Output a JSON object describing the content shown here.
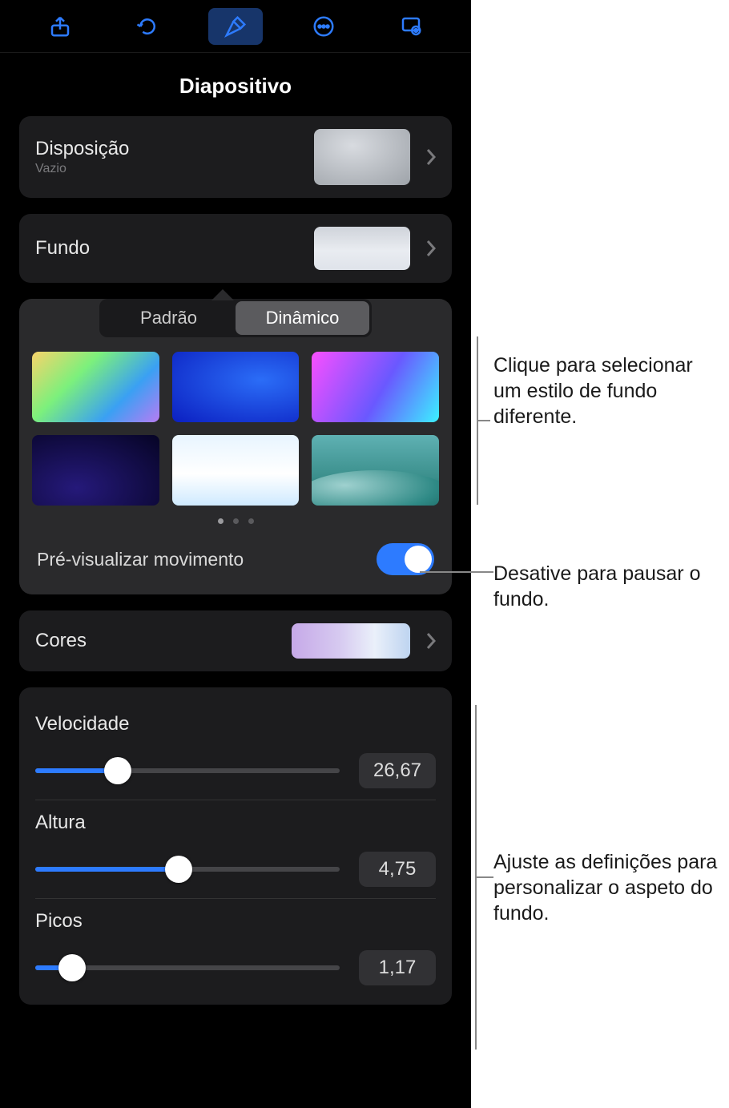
{
  "toolbar": {
    "icons": [
      "share-icon",
      "undo-icon",
      "format-icon",
      "more-icon",
      "presenter-icon"
    ],
    "active_index": 2
  },
  "header": {
    "title": "Diapositivo"
  },
  "layout_row": {
    "label": "Disposição",
    "sublabel": "Vazio"
  },
  "fundo_row": {
    "label": "Fundo"
  },
  "segmented": {
    "options": [
      "Padrão",
      "Dinâmico"
    ],
    "active_index": 1
  },
  "bg_tiles": [
    "rainbow",
    "deep-blue",
    "magenta-cyan",
    "nebula",
    "white-cloud",
    "teal-hills"
  ],
  "page_dots": {
    "count": 3,
    "active": 0
  },
  "preview": {
    "label": "Pré-visualizar movimento",
    "on": true
  },
  "cores_row": {
    "label": "Cores"
  },
  "sliders": [
    {
      "name": "velocidade",
      "label": "Velocidade",
      "value": "26,67",
      "fill_pct": 27
    },
    {
      "name": "altura",
      "label": "Altura",
      "value": "4,75",
      "fill_pct": 47
    },
    {
      "name": "picos",
      "label": "Picos",
      "value": "1,17",
      "fill_pct": 12
    }
  ],
  "callouts": {
    "styles": "Clique para selecionar um estilo de fundo diferente.",
    "switch": "Desative para pausar o fundo.",
    "sliders": "Ajuste as definições para personalizar o aspeto do fundo."
  }
}
